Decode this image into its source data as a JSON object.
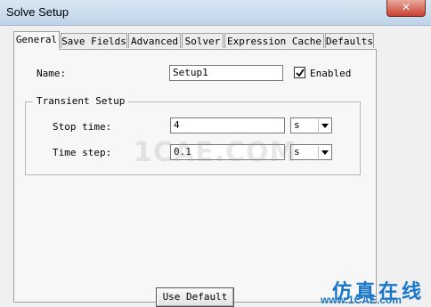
{
  "window": {
    "title": "Solve Setup",
    "close_label": "✕"
  },
  "tabs": [
    {
      "label": "General"
    },
    {
      "label": "Save Fields"
    },
    {
      "label": "Advanced"
    },
    {
      "label": "Solver"
    },
    {
      "label": "Expression Cache"
    },
    {
      "label": "Defaults"
    }
  ],
  "general": {
    "name_label": "Name:",
    "name_value": "Setup1",
    "enabled_label": "Enabled",
    "enabled_checked": true,
    "transient_group_label": "Transient Setup",
    "stop_time_label": "Stop time:",
    "stop_time_value": "4",
    "stop_time_unit": "s",
    "time_step_label": "Time step:",
    "time_step_value": "0.1",
    "time_step_unit": "s",
    "use_default_label": "Use Default"
  },
  "watermark": {
    "center_text": "1CAE.COM",
    "chinese_text": "仿真在线",
    "url_text": "www.1CAE.com"
  }
}
